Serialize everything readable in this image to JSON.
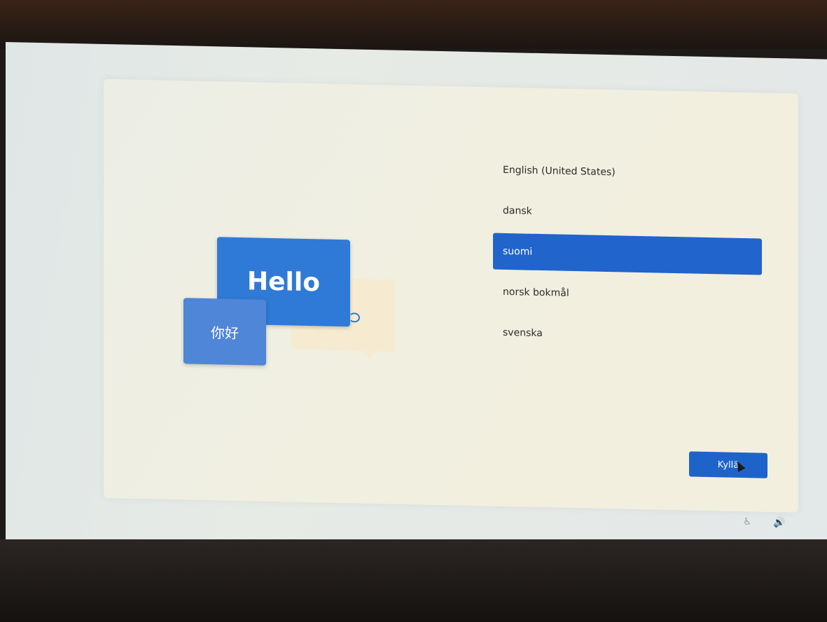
{
  "illustration": {
    "hello_text": "Hello",
    "nihao_text": "你好"
  },
  "languages": [
    {
      "label": "English (United States)",
      "selected": false
    },
    {
      "label": "dansk",
      "selected": false
    },
    {
      "label": "suomi",
      "selected": true
    },
    {
      "label": "norsk bokmål",
      "selected": false
    },
    {
      "label": "svenska",
      "selected": false
    }
  ],
  "buttons": {
    "yes_label": "Kyllä"
  },
  "tray": {
    "accessibility_icon": "accessibility-icon",
    "volume_icon": "volume-icon",
    "accessibility_glyph": "♿",
    "volume_glyph": "🔊"
  },
  "colors": {
    "accent": "#2064cc",
    "hello_card": "#2f7ad6",
    "nihao_card": "#4f86d8"
  }
}
